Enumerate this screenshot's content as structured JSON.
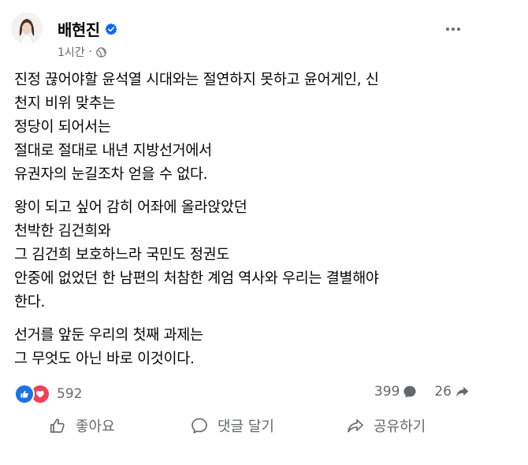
{
  "post": {
    "author": "배현진",
    "time": "1시간",
    "separator": "·",
    "paragraphs": [
      [
        "진정 끊어야할 윤석열 시대와는 절연하지 못하고 윤어게인, 신",
        "천지 비위 맞추는",
        "정당이 되어서는",
        "절대로 절대로 내년 지방선거에서",
        "유권자의 눈길조차 얻을 수 없다."
      ],
      [
        "왕이 되고 싶어 감히 어좌에 올라앉았던",
        "천박한 김건희와",
        "그 김건희 보호하느라 국민도 정권도",
        "안중에 없었던 한 남편의 처참한 계엄 역사와 우리는 결별해야",
        "한다."
      ],
      [
        "선거를 앞둔 우리의 첫째 과제는",
        "그 무엇도 아닌 바로 이것이다."
      ]
    ]
  },
  "stats": {
    "reactions": "592",
    "comments": "399",
    "shares": "26"
  },
  "actions": {
    "like": "좋아요",
    "comment": "댓글 달기",
    "share": "공유하기"
  },
  "colors": {
    "like_blue": "#1b74e4",
    "love_red": "#f33e58",
    "secondary_text": "#65676b"
  },
  "icons": [
    "avatar",
    "verified-badge-icon",
    "globe-icon",
    "more-options-icon",
    "like-reaction-icon",
    "love-reaction-icon",
    "comment-icon",
    "share-icon",
    "thumbs-up-icon",
    "comment-bubble-icon",
    "share-arrow-icon"
  ]
}
